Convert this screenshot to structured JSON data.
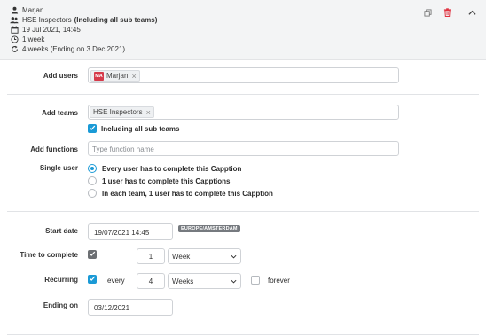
{
  "summary": {
    "user": "Marjan",
    "team_name": "HSE Inspectors",
    "team_suffix": "(Including all sub teams)",
    "datetime": "19 Jul 2021, 14:45",
    "duration": "1 week",
    "recurrence": "4 weeks (Ending on 3 Dec 2021)"
  },
  "colors": {
    "accent": "#1a9ad6",
    "delete": "#e0313f",
    "avatar": "#d63a4a"
  },
  "form": {
    "add_users": {
      "label": "Add users",
      "chips": [
        {
          "initials": "MA",
          "name": "Marjan"
        }
      ]
    },
    "add_teams": {
      "label": "Add teams",
      "chips": [
        {
          "name": "HSE Inspectors"
        }
      ],
      "include_sub_label": "Including all sub teams",
      "include_sub_checked": true
    },
    "add_functions": {
      "label": "Add functions",
      "placeholder": "Type function name"
    },
    "single_user": {
      "label": "Single user",
      "options": [
        {
          "label": "Every user has to complete this Capption",
          "selected": true
        },
        {
          "label": "1 user has to complete this Capptions",
          "selected": false
        },
        {
          "label": "In each team, 1 user has to complete this Capption",
          "selected": false
        }
      ]
    },
    "start_date": {
      "label": "Start date",
      "value": "19/07/2021 14:45",
      "timezone": "EUROPE/AMSTERDAM"
    },
    "time_to_complete": {
      "label": "Time to complete",
      "checked": true,
      "amount": "1",
      "unit": "Week"
    },
    "recurring": {
      "label": "Recurring",
      "checked": true,
      "every_label": "every",
      "amount": "4",
      "unit": "Weeks",
      "forever_label": "forever",
      "forever_checked": false
    },
    "ending_on": {
      "label": "Ending on",
      "value": "03/12/2021"
    }
  }
}
